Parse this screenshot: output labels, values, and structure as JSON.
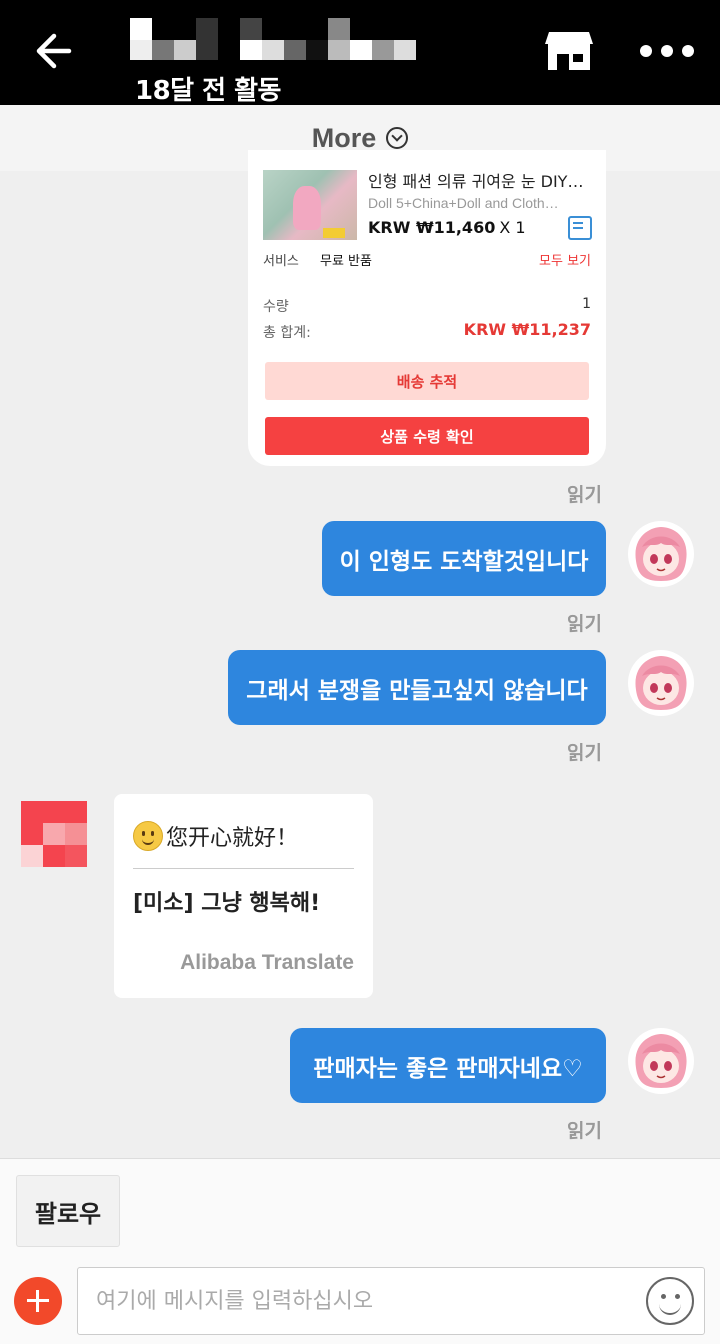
{
  "header": {
    "status_text": "18달 전 활동"
  },
  "more_bar": {
    "label": "More"
  },
  "order_card": {
    "product_name": "인형 패션 의류 귀여운 눈 DIY…",
    "product_spec": "Doll 5+China+Doll and Cloth…",
    "price": "KRW ₩11,460",
    "quantity_text": "X 1",
    "service_label": "서비스",
    "service_value": "무료 반품",
    "view_all": "모두 보기",
    "qty_label": "수량",
    "qty_value": "1",
    "total_label": "총 합계:",
    "total_value": "KRW ₩11,237",
    "track_button": "배송 추적",
    "confirm_button": "상품 수령 확인"
  },
  "messages": {
    "read_label": "읽기",
    "out_1": "이 인형도 도착할것입니다",
    "out_2": "그래서 분쟁을 만들고싶지 않습니다",
    "in_original": "您开心就好！",
    "in_translated": "[미소] 그냥 행복해!",
    "in_translator": "Alibaba Translate",
    "out_3": "판매자는 좋은 판매자네요♡"
  },
  "bottom": {
    "follow_button": "팔로우",
    "input_placeholder": "여기에 메시지를 입력하십시오"
  },
  "colors": {
    "header_bg": "#000000",
    "bubble_out": "#2e86de",
    "accent_red": "#f54141",
    "price_red": "#e53935"
  },
  "icons": [
    "back-arrow-icon",
    "store-icon",
    "more-dots-icon",
    "chevron-down-icon",
    "receipt-icon",
    "plus-icon",
    "emoji-icon"
  ]
}
